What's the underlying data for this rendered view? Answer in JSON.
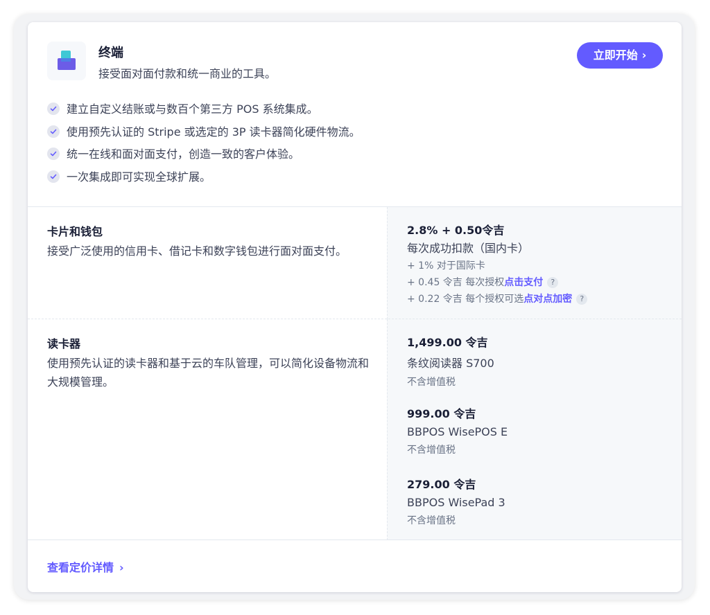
{
  "header": {
    "title": "终端",
    "subtitle": "接受面对面付款和统一商业的工具。",
    "start_button": "立即开始",
    "icon": "terminal-app-icon"
  },
  "features": [
    "建立自定义结账或与数百个第三方 POS 系统集成。",
    "使用预先认证的 Stripe 或选定的 3P 读卡器简化硬件物流。",
    "统一在线和面对面支付，创造一致的客户体验。",
    "一次集成即可实现全球扩展。"
  ],
  "cards_wallets": {
    "title": "卡片和钱包",
    "description": "接受广泛使用的信用卡、借记卡和数字钱包进行面对面支付。",
    "price": "2.8% + 0.50令吉",
    "price_desc": "每次成功扣款（国内卡）",
    "note1": "+ 1% 对于国际卡",
    "note2_prefix": "+ 0.45 令吉 每次授权",
    "note2_link": "点击支付",
    "note3_prefix": "+ 0.22 令吉 每个授权可选",
    "note3_link": "点对点加密"
  },
  "readers": {
    "title": "读卡器",
    "description": "使用预先认证的读卡器和基于云的车队管理，可以简化设备物流和大规模管理。",
    "items": [
      {
        "price": "1,499.00 令吉",
        "name": "条纹阅读器 S700",
        "tax": "不含增值税"
      },
      {
        "price": "999.00 令吉",
        "name": "BBPOS WisePOS E",
        "tax": "不含增值税"
      },
      {
        "price": "279.00 令吉",
        "name": "BBPOS WisePad 3",
        "tax": "不含增值税"
      }
    ]
  },
  "footer": {
    "link": "查看定价详情"
  },
  "colors": {
    "accent": "#635bff",
    "text_dark": "#1a1f36",
    "text_body": "#3c4257",
    "text_muted": "#697386"
  }
}
